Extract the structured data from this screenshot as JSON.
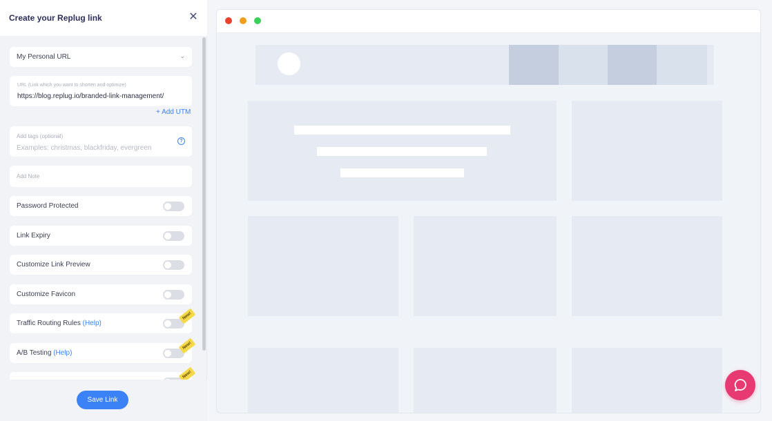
{
  "panel": {
    "title": "Create your Replug link",
    "close_icon": "✕",
    "link_type": {
      "selected": "My Personal URL",
      "chevron": "⌄"
    },
    "url": {
      "label": "URL (Link which you want to shorten and optimize)",
      "value": "https://blog.replug.io/branded-link-management/"
    },
    "add_utm": "+ Add UTM",
    "tags": {
      "label": "Add tags (optional)",
      "placeholder": "Examples: christmas, blackfriday, evergreen",
      "help_icon": "?"
    },
    "note": {
      "placeholder": "Add Note"
    },
    "toggles": [
      {
        "label": "Password Protected",
        "help": "",
        "on": false,
        "badge": ""
      },
      {
        "label": "Link Expiry",
        "help": "",
        "on": false,
        "badge": ""
      },
      {
        "label": "Customize Link Preview",
        "help": "",
        "on": false,
        "badge": ""
      },
      {
        "label": "Customize Favicon",
        "help": "",
        "on": false,
        "badge": ""
      },
      {
        "label": "Traffic Routing Rules",
        "help": "(Help)",
        "on": false,
        "badge": "New!"
      },
      {
        "label": "A/B Testing",
        "help": "(Help)",
        "on": false,
        "badge": "New!"
      },
      {
        "label": "",
        "help": "",
        "on": false,
        "badge": "New!"
      }
    ],
    "save_button": "Save Link"
  },
  "preview": {
    "window_dots": [
      "#e8412c",
      "#f0a020",
      "#3ccf5a"
    ]
  },
  "colors": {
    "accent": "#3b82f6",
    "chat": "#e83a72",
    "badge": "#f5d94a"
  }
}
